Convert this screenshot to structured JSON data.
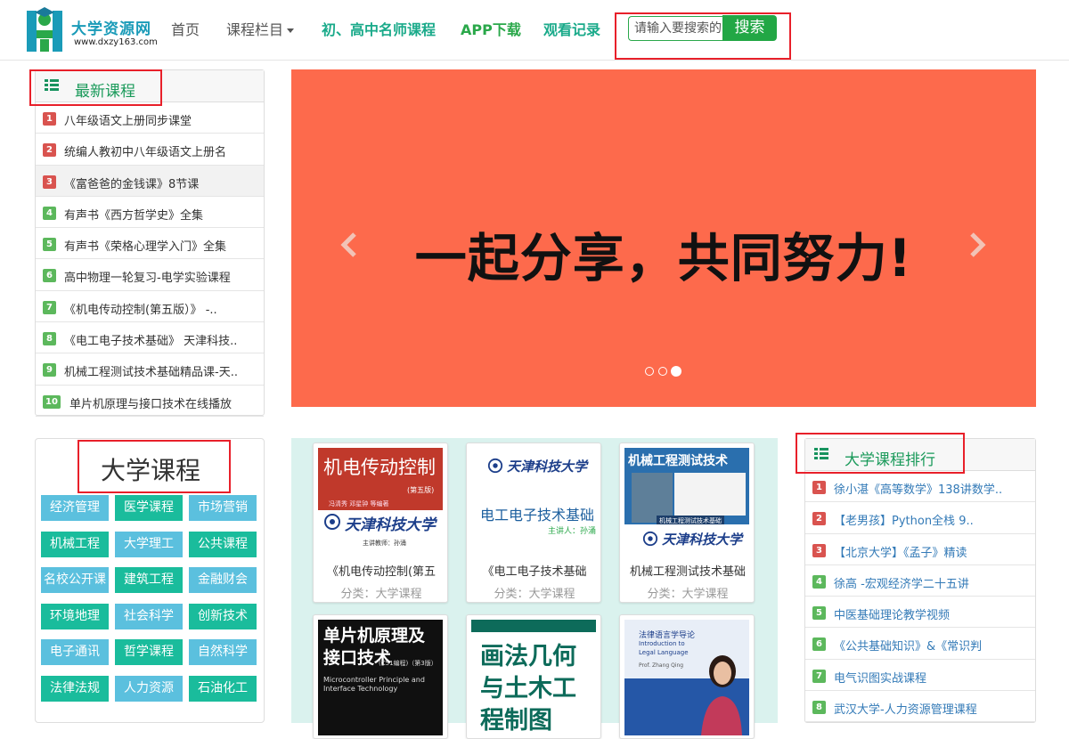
{
  "site": {
    "name": "大学资源网",
    "url": "www.dxzy163.com"
  },
  "nav": {
    "home": "首页",
    "columns": "课程栏目",
    "famous": "初、高中名师课程",
    "app": "APP下载",
    "history": "观看记录"
  },
  "search": {
    "placeholder": "请输入要搜索的",
    "button": "搜索"
  },
  "latest": {
    "title": "最新课程",
    "items": [
      {
        "num": "1",
        "label": "八年级语文上册同步课堂"
      },
      {
        "num": "2",
        "label": "统编人教初中八年级语文上册名"
      },
      {
        "num": "3",
        "label": "《富爸爸的金钱课》8节课"
      },
      {
        "num": "4",
        "label": "有声书《西方哲学史》全集"
      },
      {
        "num": "5",
        "label": "有声书《荣格心理学入门》全集"
      },
      {
        "num": "6",
        "label": "高中物理一轮复习-电学实验课程"
      },
      {
        "num": "7",
        "label": "《机电传动控制(第五版）》 -.."
      },
      {
        "num": "8",
        "label": "《电工电子技术基础》 天津科技.."
      },
      {
        "num": "9",
        "label": "机械工程测试技术基础精品课-天.."
      },
      {
        "num": "10",
        "label": "单片机原理与接口技术在线播放"
      }
    ]
  },
  "banner": {
    "text": "一起分享，共同努力!",
    "slides": 3,
    "active_slide": 3
  },
  "university": {
    "title": "大学课程",
    "tags": [
      "经济管理",
      "医学课程",
      "市场营销",
      "机械工程",
      "大学理工",
      "公共课程",
      "名校公开课",
      "建筑工程",
      "金融财会",
      "环境地理",
      "社会科学",
      "创新技术",
      "电子通讯",
      "哲学课程",
      "自然科学",
      "法律法规",
      "人力资源",
      "石油化工"
    ]
  },
  "courses": [
    {
      "title": "《机电传动控制(第五",
      "category": "分类：大学课程",
      "cover_title": "机电传动控制",
      "cover_sub": "(第五版)",
      "cover_authors": "冯清秀  邓星钟  等编著",
      "cover_school": "天津科技大学",
      "cover_teacher": "主讲教师：孙涌"
    },
    {
      "title": "《电工电子技术基础",
      "category": "分类：大学课程",
      "cover_school": "天津科技大学",
      "cover_title": "电工电子技术基础",
      "cover_teacher": "主讲人：孙涌"
    },
    {
      "title": "机械工程测试技术基础",
      "category": "分类：大学课程",
      "cover_title": "机械工程测试技术",
      "cover_sub": "机械工程测试技术基础",
      "cover_school": "天津科技大学"
    },
    {
      "cover_title": "单片机原理及接口技术",
      "cover_sub": "(C51编程)（第3版）",
      "cover_en": "Microcontroller Principle and Interface Technology"
    },
    {
      "cover_title": "画法几何与土木工程制图"
    },
    {
      "cover_title": "法律语言学导论",
      "cover_en": "Introduction to Legal Language",
      "cover_author": "Prof. Zhang Qing"
    }
  ],
  "ranking": {
    "title": "大学课程排行",
    "items": [
      {
        "num": "1",
        "label": "徐小湛《高等数学》138讲数学.."
      },
      {
        "num": "2",
        "label": "【老男孩】Python全栈 9.."
      },
      {
        "num": "3",
        "label": "【北京大学】《孟子》精读"
      },
      {
        "num": "4",
        "label": "徐高 -宏观经济学二十五讲"
      },
      {
        "num": "5",
        "label": "中医基础理论教学视频"
      },
      {
        "num": "6",
        "label": "《公共基础知识》&《常识判"
      },
      {
        "num": "7",
        "label": "电气识图实战课程"
      },
      {
        "num": "8",
        "label": "武汉大学-人力资源管理课程"
      }
    ]
  },
  "colors": {
    "banner": "#fd6a4c",
    "accent_green": "#22a745",
    "highlight_red": "#e8202a",
    "tag_blue": "#5bc0de",
    "tag_green": "#1abc9c"
  }
}
